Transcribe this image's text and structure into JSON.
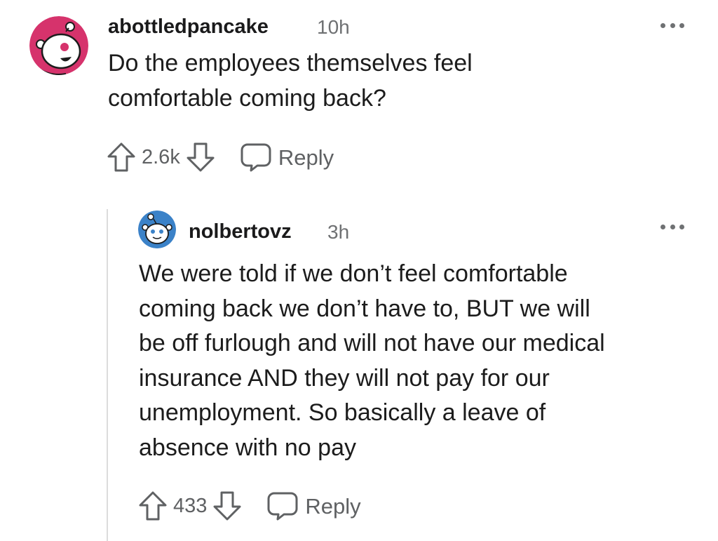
{
  "comments": [
    {
      "username": "abottledpancake",
      "time": "10h",
      "body": "Do the employees themselves feel\ncomfortable coming back?",
      "votes": "2.6k",
      "reply_label": "Reply",
      "avatar_color": "#d6336c",
      "avatar_icon": "reddit-snoo-icon"
    },
    {
      "username": "nolbertovz",
      "time": "3h",
      "body": "We were told if we don’t feel comfortable\ncoming back we don’t have to, BUT we will\nbe off furlough and will not have our medical\ninsurance AND they will not pay for our\nunemployment. So basically a leave of\nabsence with no pay",
      "votes": "433",
      "reply_label": "Reply",
      "avatar_color": "#3b82c8",
      "avatar_icon": "reddit-snoo-icon"
    }
  ],
  "colors": {
    "text": "#1c1c1c",
    "meta": "#6f7173",
    "thread_line": "#dcdcdc"
  }
}
